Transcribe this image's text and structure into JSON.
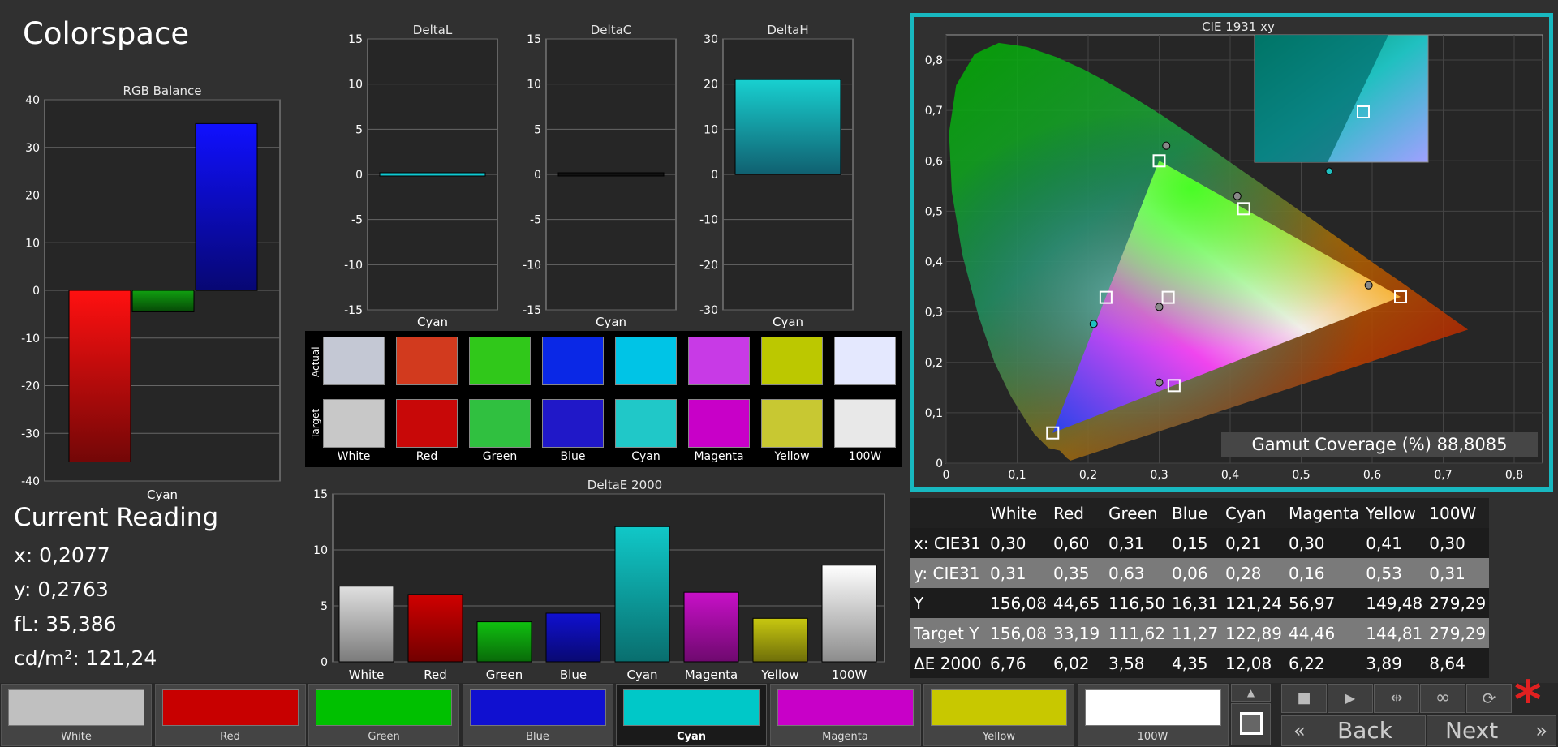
{
  "page": {
    "title": "Colorspace"
  },
  "rgb_balance": {
    "title": "RGB Balance",
    "category": "Cyan",
    "ylim": [
      -40,
      40
    ],
    "ticks": [
      "40",
      "30",
      "20",
      "10",
      "0",
      "-10",
      "-20",
      "-30",
      "-40"
    ],
    "bars": [
      {
        "name": "Red",
        "value": -36,
        "color": "#ff1010"
      },
      {
        "name": "Green",
        "value": -4.5,
        "color": "#10a010"
      },
      {
        "name": "Blue",
        "value": 35,
        "color": "#1010ff"
      }
    ]
  },
  "delta_l": {
    "title": "DeltaL",
    "category": "Cyan",
    "ticks": [
      "15",
      "10",
      "5",
      "0",
      "-5",
      "-10",
      "-15"
    ],
    "value": 0,
    "max": 15
  },
  "delta_c": {
    "title": "DeltaC",
    "category": "Cyan",
    "ticks": [
      "15",
      "10",
      "5",
      "0",
      "-5",
      "-10",
      "-15"
    ],
    "value": 0,
    "max": 15
  },
  "delta_h": {
    "title": "DeltaH",
    "category": "Cyan",
    "ticks": [
      "30",
      "20",
      "10",
      "0",
      "-10",
      "-20",
      "-30"
    ],
    "value": 21,
    "max": 30
  },
  "swatches": {
    "actual_label": "Actual",
    "target_label": "Target",
    "items": [
      {
        "name": "White",
        "actual": "#c4c8d4",
        "target": "#c8c8c8"
      },
      {
        "name": "Red",
        "actual": "#d23a1e",
        "target": "#c80808"
      },
      {
        "name": "Green",
        "actual": "#30c81a",
        "target": "#30c040"
      },
      {
        "name": "Blue",
        "actual": "#0a28e6",
        "target": "#2018c8"
      },
      {
        "name": "Cyan",
        "actual": "#00c4e6",
        "target": "#20c8c8"
      },
      {
        "name": "Magenta",
        "actual": "#c83ae6",
        "target": "#c800c8"
      },
      {
        "name": "Yellow",
        "actual": "#bcc800",
        "target": "#c8c832"
      },
      {
        "name": "100W",
        "actual": "#e4e8fe",
        "target": "#e8e8e8"
      }
    ]
  },
  "delta_e": {
    "title": "DeltaE 2000",
    "ticks": [
      "15",
      "10",
      "5",
      "0"
    ],
    "max": 15,
    "bars": [
      {
        "name": "White",
        "value": 6.76,
        "color": "#e0e0e0"
      },
      {
        "name": "Red",
        "value": 6.02,
        "color": "#d00000"
      },
      {
        "name": "Green",
        "value": 3.58,
        "color": "#10c010"
      },
      {
        "name": "Blue",
        "value": 4.35,
        "color": "#1010d0"
      },
      {
        "name": "Cyan",
        "value": 12.08,
        "color": "#10c8c8"
      },
      {
        "name": "Magenta",
        "value": 6.22,
        "color": "#c810c8"
      },
      {
        "name": "Yellow",
        "value": 3.89,
        "color": "#c8c810"
      },
      {
        "name": "100W",
        "value": 8.64,
        "color": "#ffffff"
      }
    ]
  },
  "current_reading": {
    "title": "Current Reading",
    "x": "x: 0,2077",
    "y": "y: 0,2763",
    "fl": "fL: 35,386",
    "cdm2": "cd/m²: 121,24"
  },
  "cie": {
    "title": "CIE 1931 xy",
    "x_ticks": [
      "0",
      "0,1",
      "0,2",
      "0,3",
      "0,4",
      "0,5",
      "0,6",
      "0,7",
      "0,8"
    ],
    "y_ticks": [
      "0,8",
      "0,7",
      "0,6",
      "0,5",
      "0,4",
      "0,3",
      "0,2",
      "0,1",
      "0"
    ],
    "gamut_label": "Gamut Coverage (%) 88,8085",
    "targets": [
      {
        "name": "Red",
        "x": 0.64,
        "y": 0.33
      },
      {
        "name": "Green",
        "x": 0.3,
        "y": 0.6
      },
      {
        "name": "Blue",
        "x": 0.15,
        "y": 0.06
      },
      {
        "name": "Cyan",
        "x": 0.225,
        "y": 0.329
      },
      {
        "name": "Magenta",
        "x": 0.321,
        "y": 0.154
      },
      {
        "name": "Yellow",
        "x": 0.419,
        "y": 0.505
      },
      {
        "name": "White",
        "x": 0.3127,
        "y": 0.329
      }
    ],
    "measured": [
      {
        "name": "Red",
        "x": 0.595,
        "y": 0.353
      },
      {
        "name": "Green",
        "x": 0.31,
        "y": 0.63
      },
      {
        "name": "Cyan",
        "x": 0.2077,
        "y": 0.2763
      },
      {
        "name": "Magenta",
        "x": 0.3,
        "y": 0.16
      },
      {
        "name": "Yellow",
        "x": 0.41,
        "y": 0.53
      },
      {
        "name": "White",
        "x": 0.3,
        "y": 0.31
      }
    ]
  },
  "table": {
    "headers": [
      "",
      "White",
      "Red",
      "Green",
      "Blue",
      "Cyan",
      "Magenta",
      "Yellow",
      "100W"
    ],
    "rows": [
      [
        "x: CIE31",
        "0,30",
        "0,60",
        "0,31",
        "0,15",
        "0,21",
        "0,30",
        "0,41",
        "0,30"
      ],
      [
        "y: CIE31",
        "0,31",
        "0,35",
        "0,63",
        "0,06",
        "0,28",
        "0,16",
        "0,53",
        "0,31"
      ],
      [
        "Y",
        "156,08",
        "44,65",
        "116,50",
        "16,31",
        "121,24",
        "56,97",
        "149,48",
        "279,29"
      ],
      [
        "Target Y",
        "156,08",
        "33,19",
        "111,62",
        "11,27",
        "122,89",
        "44,46",
        "144,81",
        "279,29"
      ],
      [
        "ΔE 2000",
        "6,76",
        "6,02",
        "3,58",
        "4,35",
        "12,08",
        "6,22",
        "3,89",
        "8,64"
      ]
    ]
  },
  "color_buttons": [
    {
      "label": "White",
      "color": "#c0c0c0"
    },
    {
      "label": "Red",
      "color": "#c80000"
    },
    {
      "label": "Green",
      "color": "#00c000"
    },
    {
      "label": "Blue",
      "color": "#1010d0"
    },
    {
      "label": "Cyan",
      "color": "#00c8c8"
    },
    {
      "label": "Magenta",
      "color": "#c800c8"
    },
    {
      "label": "Yellow",
      "color": "#c8c800"
    },
    {
      "label": "100W",
      "color": "#ffffff"
    }
  ],
  "controls": {
    "back_label": "Back",
    "next_label": "Next",
    "back_icon": "«",
    "next_icon": "»",
    "star_icon": "*",
    "stop_icon": "■",
    "play_icon": "▶",
    "step_icon": "⇹",
    "loop_icon": "∞",
    "refresh_icon": "⟳",
    "up_icon": "▲"
  },
  "colors": {
    "accent": "#18b8c0"
  }
}
